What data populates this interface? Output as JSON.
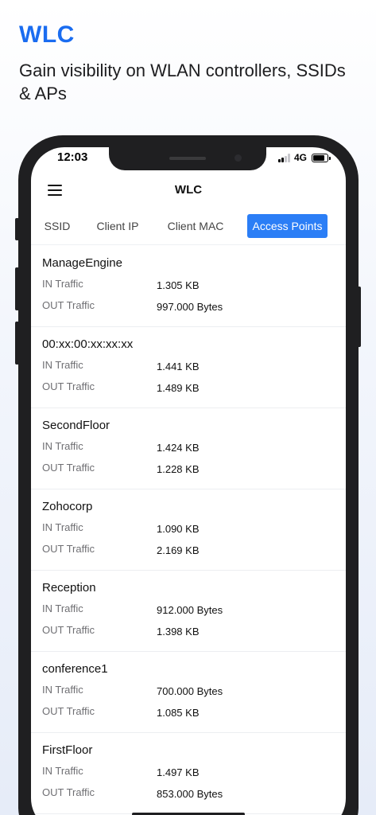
{
  "promo": {
    "title": "WLC",
    "subtitle": "Gain visibility on WLAN controllers, SSIDs & APs"
  },
  "status_bar": {
    "time": "12:03",
    "network": "4G",
    "signal_bars_active": 2,
    "signal_bars_total": 4,
    "battery_level": 0.8
  },
  "app": {
    "title": "WLC",
    "menu_icon": "hamburger-menu-icon"
  },
  "tabs": [
    {
      "label": "SSID",
      "active": false
    },
    {
      "label": "Client IP",
      "active": false
    },
    {
      "label": "Client MAC",
      "active": false
    },
    {
      "label": "Access Points",
      "active": true
    }
  ],
  "labels": {
    "in_traffic": "IN Traffic",
    "out_traffic": "OUT Traffic"
  },
  "access_points": [
    {
      "name": "ManageEngine",
      "in": "1.305 KB",
      "out": "997.000 Bytes"
    },
    {
      "name": "00:xx:00:xx:xx:xx",
      "in": "1.441 KB",
      "out": "1.489 KB"
    },
    {
      "name": "SecondFloor",
      "in": "1.424 KB",
      "out": "1.228 KB"
    },
    {
      "name": "Zohocorp",
      "in": "1.090 KB",
      "out": "2.169 KB"
    },
    {
      "name": "Reception",
      "in": "912.000 Bytes",
      "out": "1.398 KB"
    },
    {
      "name": "conference1",
      "in": "700.000 Bytes",
      "out": "1.085 KB"
    },
    {
      "name": "FirstFloor",
      "in": "1.497 KB",
      "out": "853.000 Bytes"
    }
  ],
  "colors": {
    "accent": "#2b7ef6",
    "promo_title": "#1a6cf0",
    "frame": "#1f1f21"
  }
}
